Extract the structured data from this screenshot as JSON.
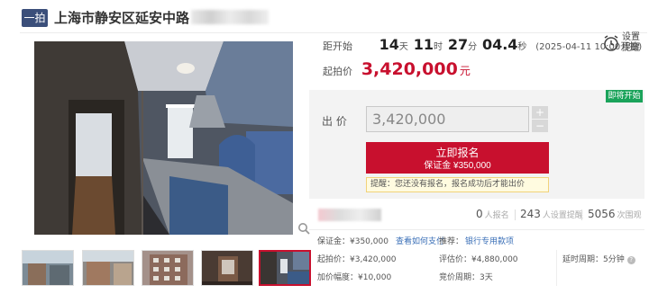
{
  "header": {
    "tag": "一拍",
    "title": "上海市静安区延安中路"
  },
  "countdown": {
    "label": "距开始",
    "days": "14",
    "days_unit": "天",
    "hours": "11",
    "hours_unit": "时",
    "minutes": "27",
    "minutes_unit": "分",
    "seconds": "04.4",
    "seconds_unit": "秒",
    "start_time": "(2025-04-11 10:00开拍)"
  },
  "starting_price": {
    "label": "起拍价",
    "value": "3,420,000",
    "unit": "元"
  },
  "reminder": {
    "line1": "设置",
    "line2": "提醒"
  },
  "bid": {
    "badge": "即将开始",
    "label": "出 价",
    "input_value": "3,420,000",
    "plus": "+",
    "minus": "−",
    "register_label": "立即报名",
    "deposit_label": "保证金 ¥350,000",
    "notice": "提醒：您还没有报名，报名成功后才能出价"
  },
  "stats": {
    "registered_count": "0",
    "registered_label": "人报名",
    "reminder_count": "243",
    "reminder_label": "人设置提醒",
    "views_count": "5056",
    "views_label": "次围观"
  },
  "info": {
    "deposit": "保证金：¥350,000",
    "how_to_pay": "查看如何支付",
    "recommend_label": "推荐：",
    "recommend_link": "银行专用款项",
    "start_price": "起拍价：¥3,420,000",
    "appraisal": "评估价：¥4,880,000",
    "delay_period": "延时周期：5分钟",
    "increment": "加价幅度：¥10,000",
    "bidding_period": "竞价周期：3天"
  },
  "icons": {
    "zoom": "magnifier-icon",
    "alarm": "alarm-clock-icon",
    "help": "question-icon"
  },
  "colors": {
    "accent_red": "#c8102e",
    "badge_navy": "#3b4f7a",
    "badge_green": "#1aa35a",
    "link_blue": "#3a6fb7"
  }
}
